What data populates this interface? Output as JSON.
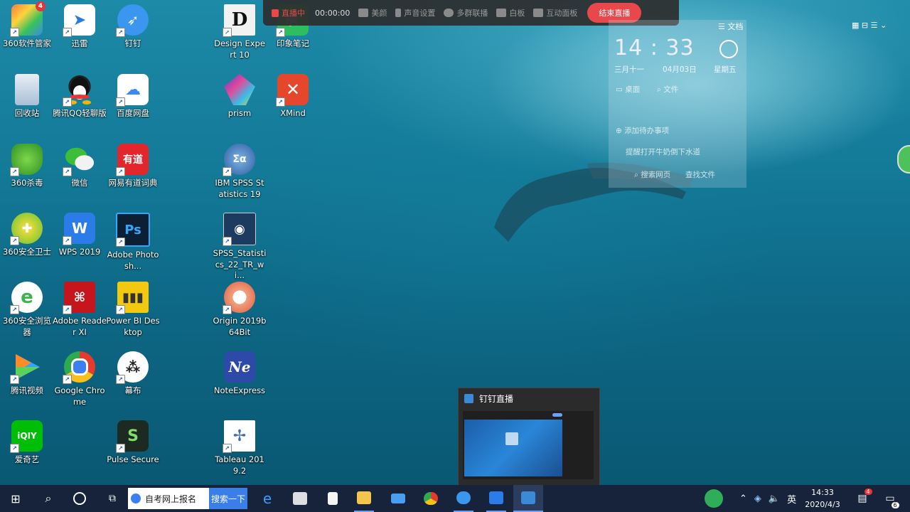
{
  "desktop_icons": [
    {
      "label": "360软件管家",
      "badge": "4"
    },
    {
      "label": "迅雷"
    },
    {
      "label": "钉钉"
    },
    {
      "label": "Design Expert 10",
      "glyph": "D"
    },
    {
      "label": "印象笔记"
    },
    {
      "label": "回收站"
    },
    {
      "label": "腾讯QQ轻聊版"
    },
    {
      "label": "百度网盘"
    },
    {
      "label": "prism"
    },
    {
      "label": "XMind"
    },
    {
      "label": "360杀毒"
    },
    {
      "label": "微信"
    },
    {
      "label": "网易有道词典",
      "glyph": "有道"
    },
    {
      "label": "IBM SPSS Statistics 19",
      "glyph": "Σα"
    },
    {
      "label": "360安全卫士"
    },
    {
      "label": "WPS 2019",
      "glyph": "W"
    },
    {
      "label": "Adobe Photosh...",
      "glyph": "Ps"
    },
    {
      "label": "SPSS_Statistics_22_TR_wi..."
    },
    {
      "label": "360安全浏览器",
      "glyph": "e"
    },
    {
      "label": "Adobe Reader XI"
    },
    {
      "label": "Power BI Desktop"
    },
    {
      "label": "Origin 2019b 64Bit"
    },
    {
      "label": "腾讯视频"
    },
    {
      "label": "Google Chrome"
    },
    {
      "label": "幕布"
    },
    {
      "label": "NoteExpress",
      "glyph": "Ne"
    },
    {
      "label": "爱奇艺",
      "glyph": "iQIY"
    },
    {
      "label": "Pulse Secure"
    },
    {
      "label": "Tableau 2019.2"
    }
  ],
  "livebar": {
    "live_label": "直播中",
    "timer": "00:00:00",
    "beauty": "美颜",
    "audio": "声音设置",
    "multi": "多群联播",
    "board": "白板",
    "interact": "互动面板",
    "end": "结束直播"
  },
  "widget": {
    "time": "14 : 33",
    "lunar": "三月十一",
    "date": "04月03日",
    "weekday": "星期五",
    "doc_label": "文档",
    "desktop": "桌面",
    "file": "文件",
    "add_todo": "添加待办事项",
    "news": "提醒打开牛奶倒下水道",
    "search_web": "搜索网页",
    "search_file": "查找文件"
  },
  "preview": {
    "title": "钉钉直播"
  },
  "taskbar": {
    "search_text": "自考网上报名",
    "search_button": "搜索一下",
    "ime": "英",
    "clock_time": "14:33",
    "clock_date": "2020/4/3",
    "notif_badge": "4",
    "action_badge": "6"
  }
}
